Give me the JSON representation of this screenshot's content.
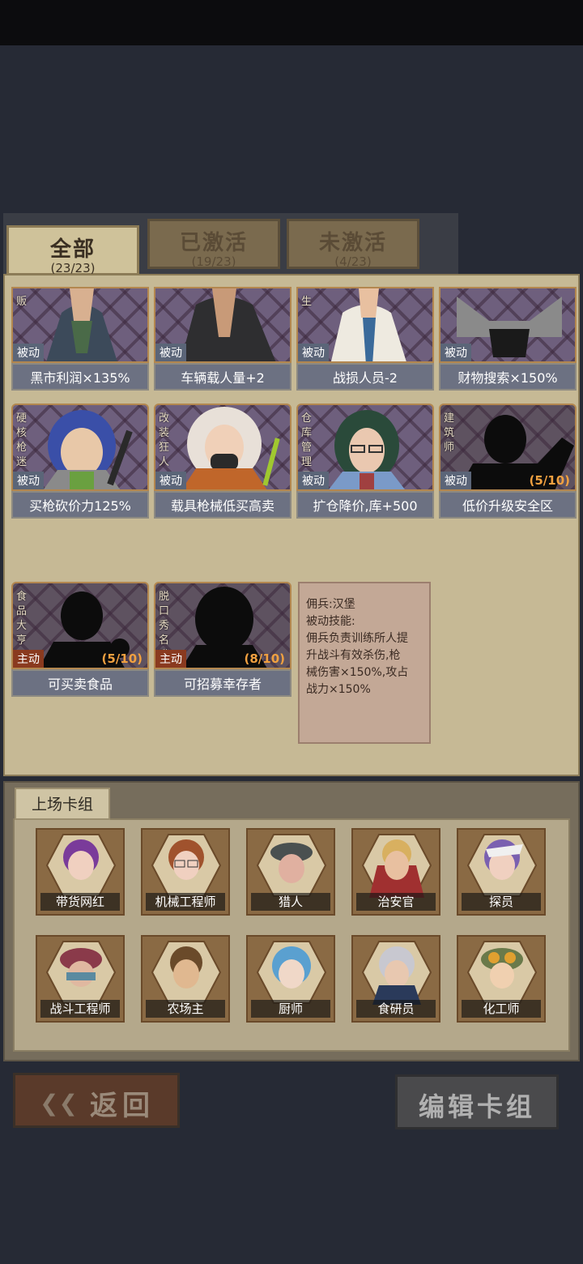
{
  "tabs": [
    {
      "label": "全部",
      "count": "(23/23)"
    },
    {
      "label": "已激活",
      "count": "(19/23)"
    },
    {
      "label": "未激活",
      "count": "(4/23)"
    }
  ],
  "cards": [
    {
      "name": "贩",
      "type": "被动",
      "ability": "黑市利润×135%",
      "progress": ""
    },
    {
      "name": "",
      "type": "被动",
      "ability": "车辆载人量+2",
      "progress": ""
    },
    {
      "name": "生",
      "type": "被动",
      "ability": "战损人员-2",
      "progress": ""
    },
    {
      "name": "",
      "type": "被动",
      "ability": "财物搜索×150%",
      "progress": ""
    },
    {
      "name": "硬核枪迷",
      "type": "被动",
      "ability": "买枪砍价力125%",
      "progress": ""
    },
    {
      "name": "改装狂人",
      "type": "被动",
      "ability": "载具枪械低买高卖",
      "progress": ""
    },
    {
      "name": "仓库管理员",
      "type": "被动",
      "ability": "扩仓降价,库+500",
      "progress": ""
    },
    {
      "name": "建筑师",
      "type": "被动",
      "ability": "低价升级安全区",
      "progress": "(5/10)"
    },
    {
      "name": "食品大亨",
      "type": "主动",
      "ability": "可买卖食品",
      "progress": "(5/10)"
    },
    {
      "name": "脱口秀名嘴",
      "type": "主动",
      "ability": "可招募幸存者",
      "progress": "(8/10)"
    }
  ],
  "info": {
    "line1": "佣兵:汉堡",
    "line2": "被动技能:",
    "line3": "佣兵负责训练所人提",
    "line4": "升战斗有效杀伤,枪",
    "line5": "械伤害×150%,攻占",
    "line6": "战力×150%"
  },
  "deck": {
    "title": "上场卡组",
    "members": [
      {
        "name": "带货网红",
        "hair": "#7a3b9a"
      },
      {
        "name": "机械工程师",
        "hair": "#a0522d"
      },
      {
        "name": "猎人",
        "hair": "#4a5050"
      },
      {
        "name": "治安官",
        "hair": "#d8b060"
      },
      {
        "name": "探员",
        "hair": "#7a60b0"
      },
      {
        "name": "战斗工程师",
        "hair": "#8a3a4a"
      },
      {
        "name": "农场主",
        "hair": "#6a4a2a"
      },
      {
        "name": "厨师",
        "hair": "#5aa0d0"
      },
      {
        "name": "食研员",
        "hair": "#c8c8d0"
      },
      {
        "name": "化工师",
        "hair": "#6a7a4a"
      }
    ]
  },
  "buttons": {
    "back": "返回",
    "edit": "编辑卡组"
  }
}
